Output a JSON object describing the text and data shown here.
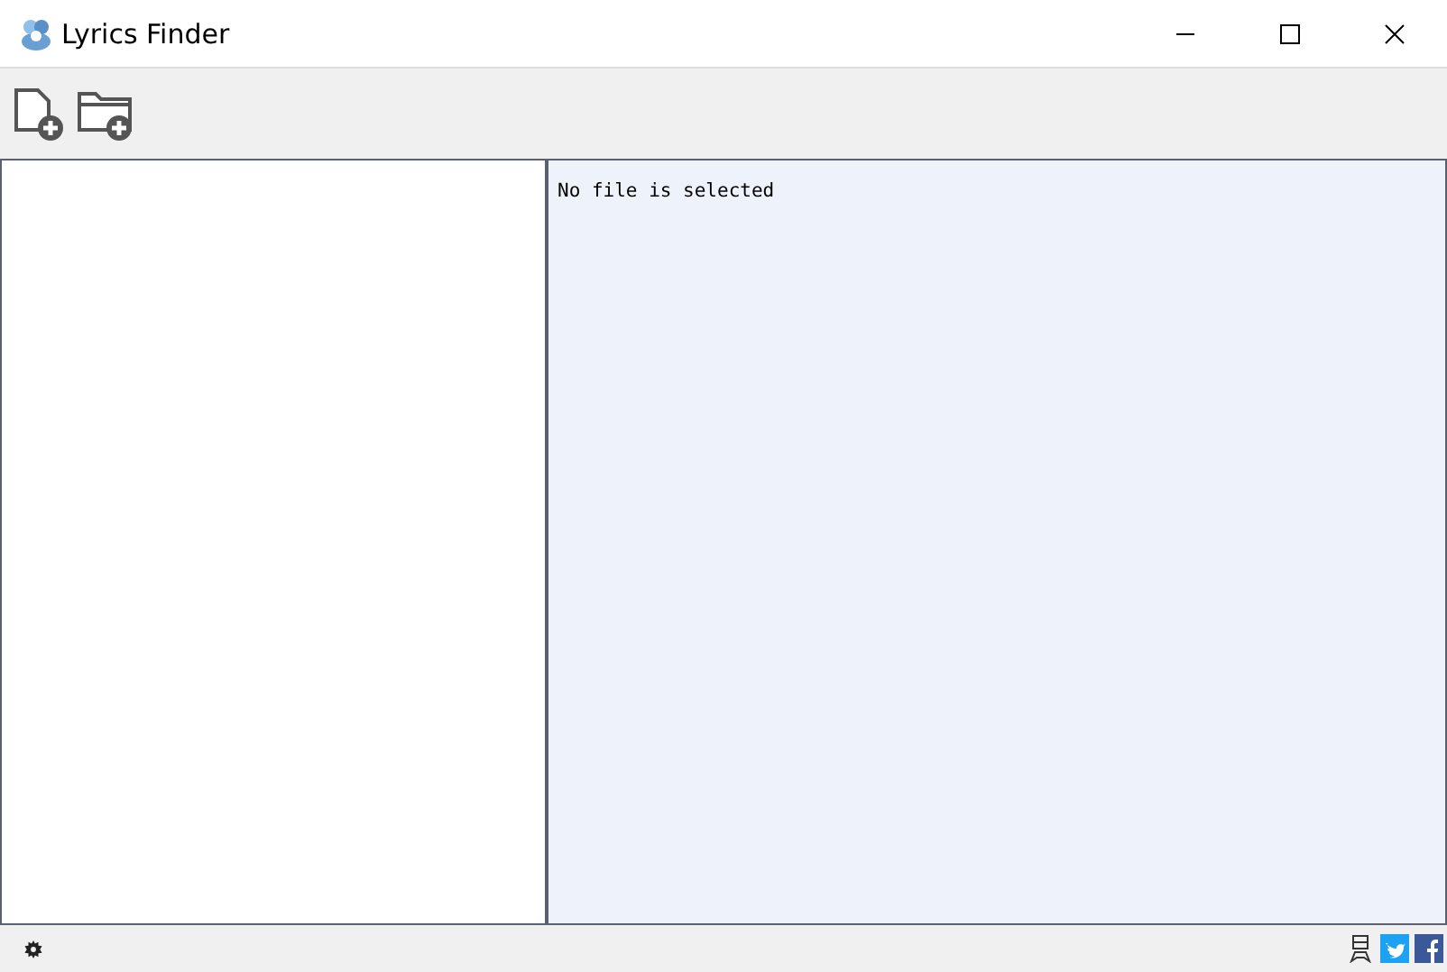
{
  "window": {
    "title": "Lyrics Finder"
  },
  "details": {
    "text": "No file is selected"
  }
}
